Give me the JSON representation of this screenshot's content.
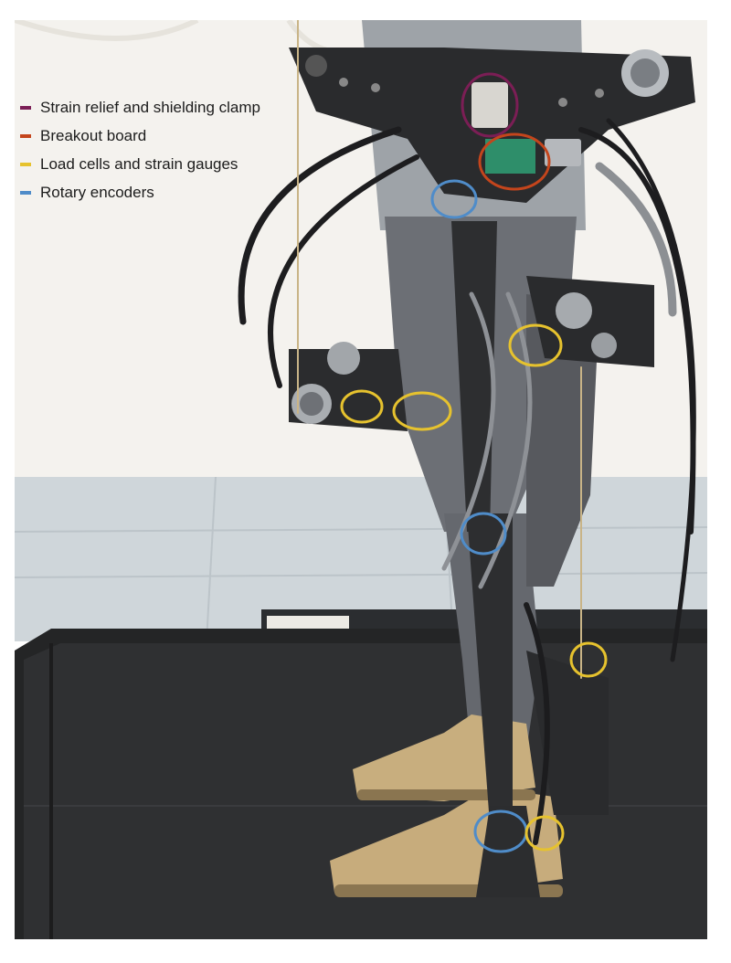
{
  "legend": {
    "items": [
      {
        "label": "Strain relief and shielding clamp",
        "color": "#7b1e55"
      },
      {
        "label": "Breakout board",
        "color": "#c4451c"
      },
      {
        "label": "Load cells and strain gauges",
        "color": "#e6c22e"
      },
      {
        "label": "Rotary encoders",
        "color": "#4f8cc9"
      }
    ]
  },
  "photo": {
    "subject": "exoskeleton-leg-on-treadmill",
    "annotation_colors": {
      "clamp": "#7b1e55",
      "breakout": "#c4451c",
      "load_cell": "#e6c22e",
      "encoder": "#4f8cc9"
    }
  }
}
